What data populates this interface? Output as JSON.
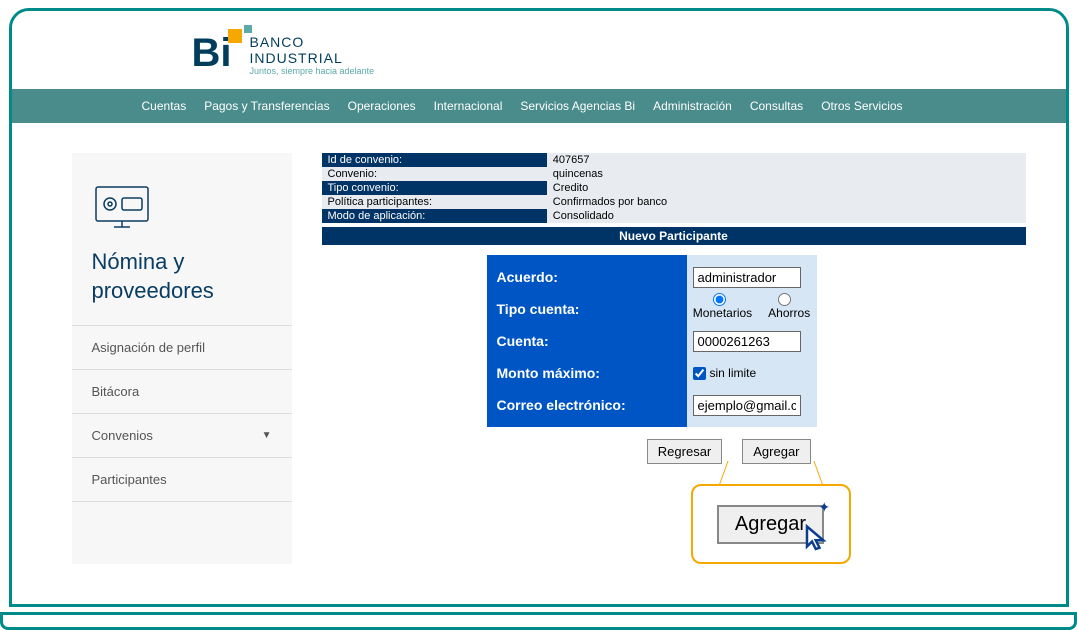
{
  "logo": {
    "title_line1": "BANCO",
    "title_line2": "INDUSTRIAL",
    "tagline": "Juntos, siempre hacia adelante"
  },
  "nav": [
    "Cuentas",
    "Pagos y Transferencias",
    "Operaciones",
    "Internacional",
    "Servicios Agencias Bi",
    "Administración",
    "Consultas",
    "Otros Servicios"
  ],
  "sidebar": {
    "title": "Nómina y proveedores",
    "items": [
      {
        "label": "Asignación de perfil",
        "expandable": false
      },
      {
        "label": "Bitácora",
        "expandable": false
      },
      {
        "label": "Convenios",
        "expandable": true
      },
      {
        "label": "Participantes",
        "expandable": false
      }
    ]
  },
  "details": [
    {
      "label": "Id de convenio:",
      "value": "407657"
    },
    {
      "label": "Convenio:",
      "value": "quincenas"
    },
    {
      "label": "Tipo convenio:",
      "value": "Credito"
    },
    {
      "label": "Política participantes:",
      "value": "Confirmados por banco"
    },
    {
      "label": "Modo de aplicación:",
      "value": "Consolidado"
    }
  ],
  "section_title": "Nuevo Participante",
  "form": {
    "labels": {
      "acuerdo": "Acuerdo:",
      "tipo_cuenta": "Tipo cuenta:",
      "cuenta": "Cuenta:",
      "monto_maximo": "Monto máximo:",
      "correo": "Correo electrónico:"
    },
    "values": {
      "acuerdo": "administrador",
      "cuenta": "0000261263",
      "correo": "ejemplo@gmail.com",
      "sin_limite_label": "sin limite",
      "monetarios": "Monetarios",
      "ahorros": "Ahorros"
    }
  },
  "buttons": {
    "regresar": "Regresar",
    "agregar": "Agregar",
    "agregar_zoom": "Agregar"
  }
}
